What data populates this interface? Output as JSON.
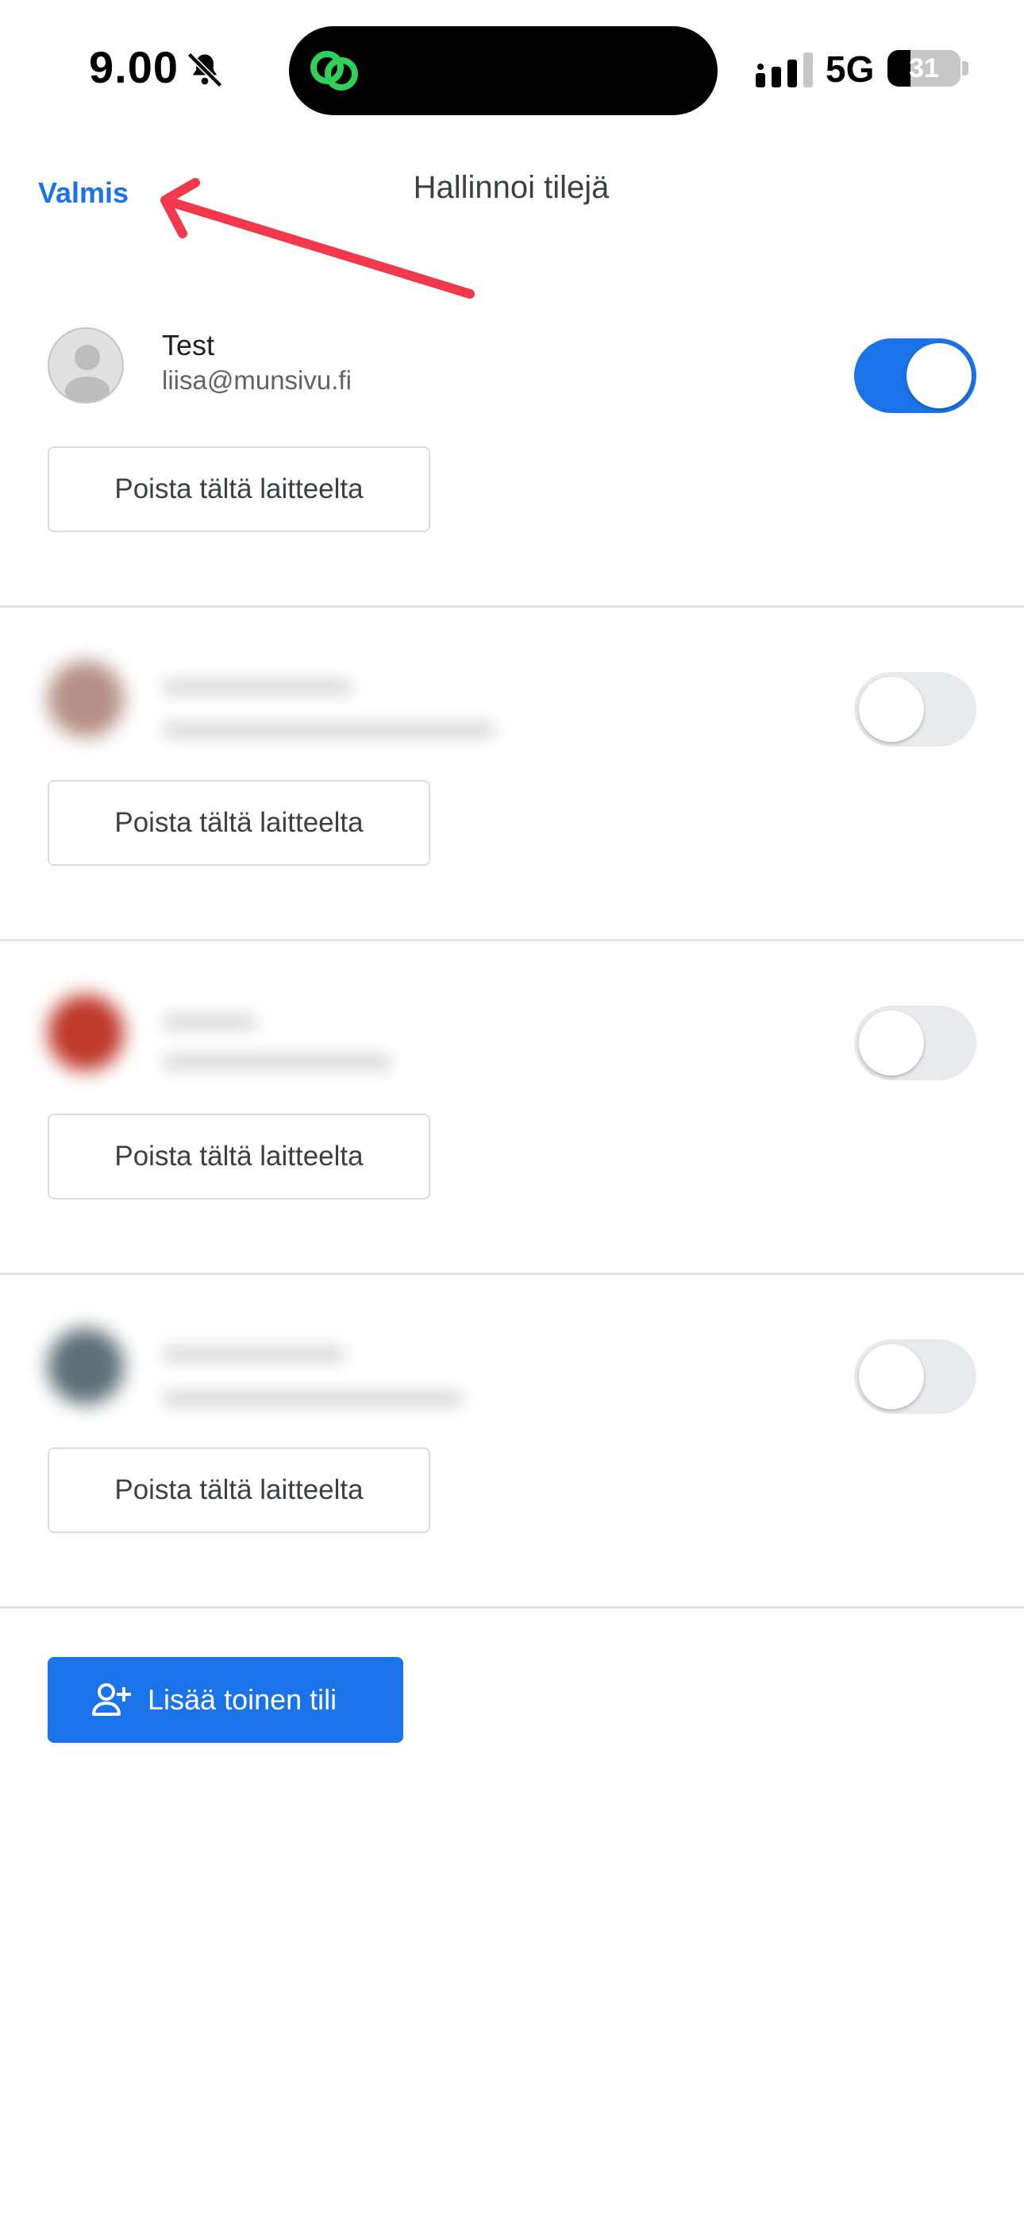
{
  "status_bar": {
    "time": "9.00",
    "network": "5G",
    "battery_level": "31",
    "battery_fraction": 0.31,
    "icons": [
      "bell-muted-icon",
      "chain-link-icon",
      "cellular-signal-icon",
      "battery-icon"
    ]
  },
  "header": {
    "done_label": "Valmis",
    "title": "Hallinnoi tilejä"
  },
  "accounts": [
    {
      "name": "Test",
      "email": "liisa@munsivu.fi",
      "enabled": true,
      "remove_label": "Poista tältä laitteelta"
    },
    {
      "name": "",
      "email": "",
      "enabled": false,
      "remove_label": "Poista tältä laitteelta"
    },
    {
      "name": "",
      "email": "",
      "enabled": false,
      "remove_label": "Poista tältä laitteelta"
    },
    {
      "name": "",
      "email": "",
      "enabled": false,
      "remove_label": "Poista tältä laitteelta"
    }
  ],
  "add_account": {
    "label": "Lisää toinen tili",
    "icon": "person-add-icon"
  },
  "colors": {
    "accent": "#1a73e8",
    "arrow": "#f2384a",
    "island_icon": "#2fd158"
  }
}
